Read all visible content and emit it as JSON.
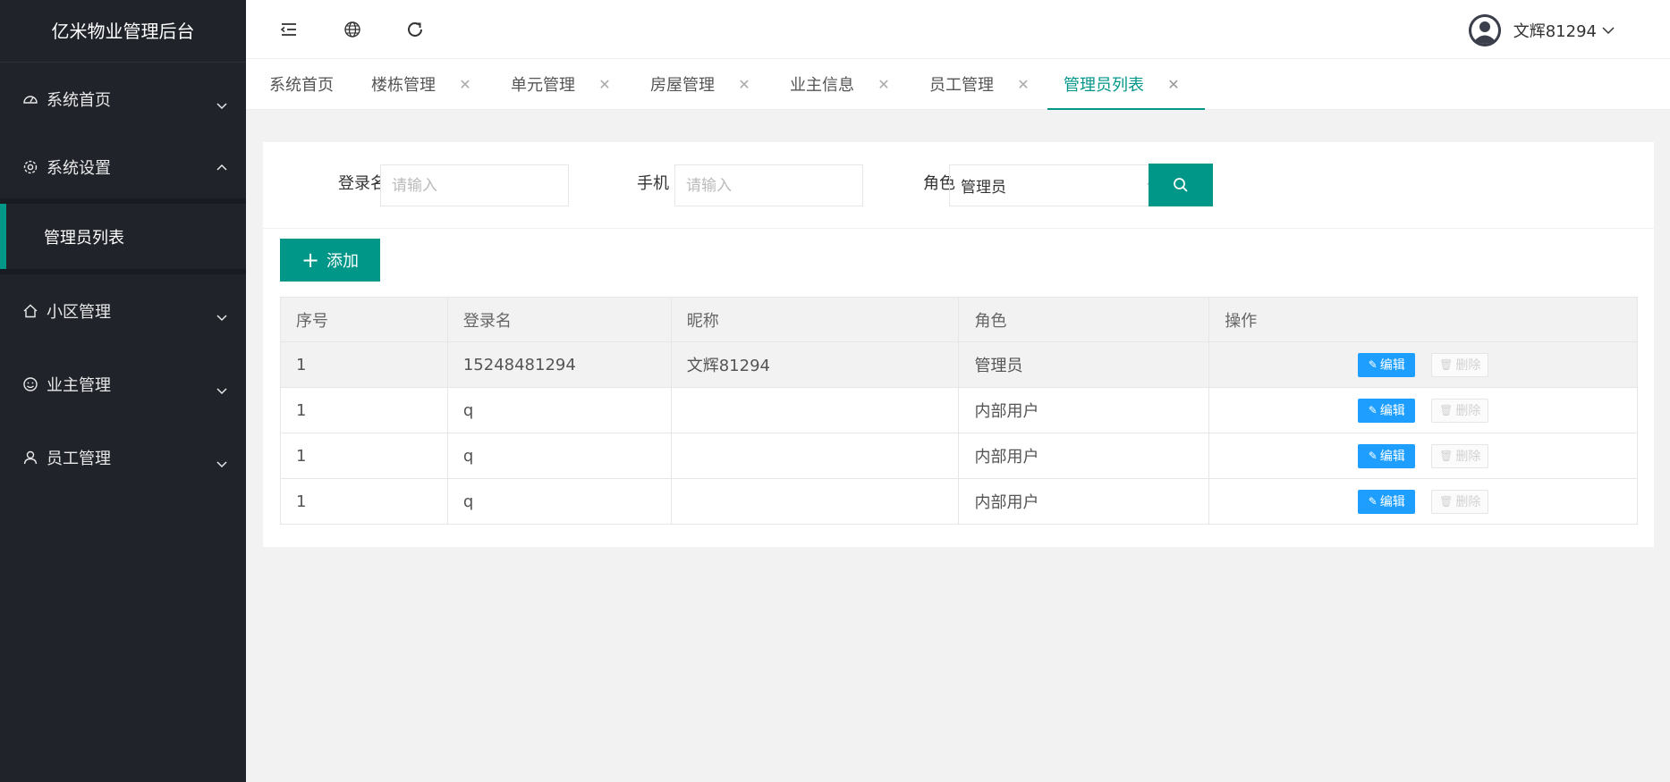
{
  "app": {
    "title": "亿米物业管理后台"
  },
  "sidebar": {
    "items": [
      {
        "label": "系统首页",
        "icon": "dashboard-icon"
      },
      {
        "label": "系统设置",
        "icon": "gear-icon",
        "open": true,
        "children": [
          {
            "label": "管理员列表",
            "active": true
          }
        ]
      },
      {
        "label": "小区管理",
        "icon": "home-icon"
      },
      {
        "label": "业主管理",
        "icon": "smile-icon"
      },
      {
        "label": "员工管理",
        "icon": "user-icon"
      }
    ]
  },
  "header": {
    "icons": [
      "menu-toggle-icon",
      "globe-icon",
      "refresh-icon"
    ],
    "user": {
      "name": "文辉81294"
    }
  },
  "tabs": [
    {
      "label": "系统首页",
      "closable": false
    },
    {
      "label": "楼栋管理",
      "closable": true
    },
    {
      "label": "单元管理",
      "closable": true
    },
    {
      "label": "房屋管理",
      "closable": true
    },
    {
      "label": "业主信息",
      "closable": true
    },
    {
      "label": "员工管理",
      "closable": true
    },
    {
      "label": "管理员列表",
      "closable": true,
      "active": true
    }
  ],
  "filters": {
    "login": {
      "label": "登录名",
      "placeholder": "请输入"
    },
    "phone": {
      "label": "手机",
      "placeholder": "请输入"
    },
    "role": {
      "label": "角色",
      "value": "管理员"
    }
  },
  "actions": {
    "add_label": "添加"
  },
  "table": {
    "columns": [
      "序号",
      "登录名",
      "昵称",
      "角色",
      "操作"
    ],
    "edit_label": "编辑",
    "delete_label": "删除",
    "rows": [
      {
        "index": "1",
        "login": "15248481294",
        "nickname": "文辉81294",
        "role": "管理员"
      },
      {
        "index": "1",
        "login": "q",
        "nickname": "",
        "role": "内部用户"
      },
      {
        "index": "1",
        "login": "q",
        "nickname": "",
        "role": "内部用户"
      },
      {
        "index": "1",
        "login": "q",
        "nickname": "",
        "role": "内部用户"
      }
    ]
  },
  "colors": {
    "sidebar_bg": "#20232a",
    "accent": "#009688",
    "edit_blue": "#1e9fff"
  }
}
